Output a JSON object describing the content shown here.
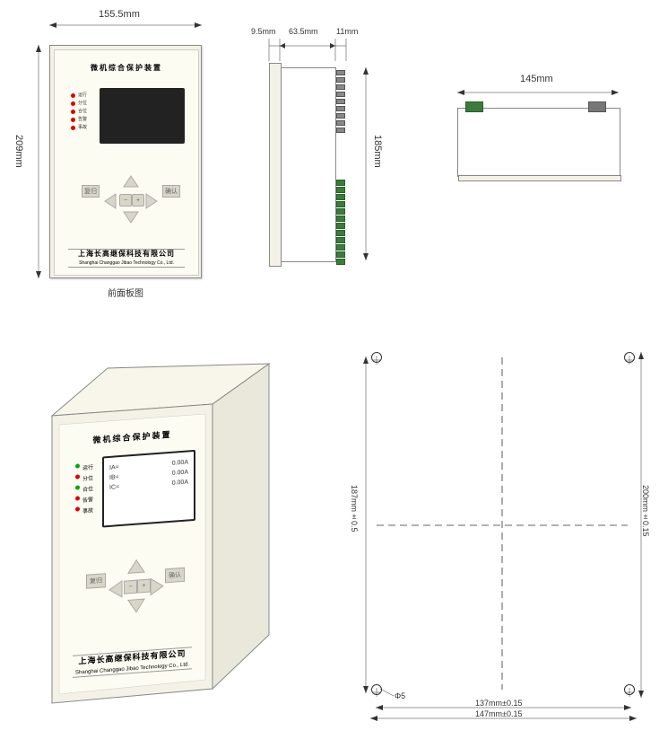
{
  "dimensions": {
    "front_width": "155.5mm",
    "front_height": "209mm",
    "side_gap1": "9.5mm",
    "side_depth": "63.5mm",
    "side_gap2": "11mm",
    "side_height": "185mm",
    "top_width": "145mm",
    "mount_height": "187mm±0.5",
    "mount_height2": "200mm±0.15",
    "mount_width1": "137mm±0.15",
    "mount_width2": "147mm±0.15",
    "hole_dia": "Φ5"
  },
  "device": {
    "title": "微机综合保护装置",
    "leds": [
      "运行",
      "分位",
      "合位",
      "告警",
      "事故"
    ],
    "company_cn": "上海长高继保科技有限公司",
    "company_en": "Shanghai Changgao Jibao Technology Co., Ltd.",
    "front_caption": "前面板图",
    "buttons": {
      "reset": "复归",
      "confirm": "确认"
    },
    "screen_lines": [
      "IA=",
      "IB=",
      "IC=",
      "0.00A",
      "0.00A",
      "0.00A"
    ]
  }
}
